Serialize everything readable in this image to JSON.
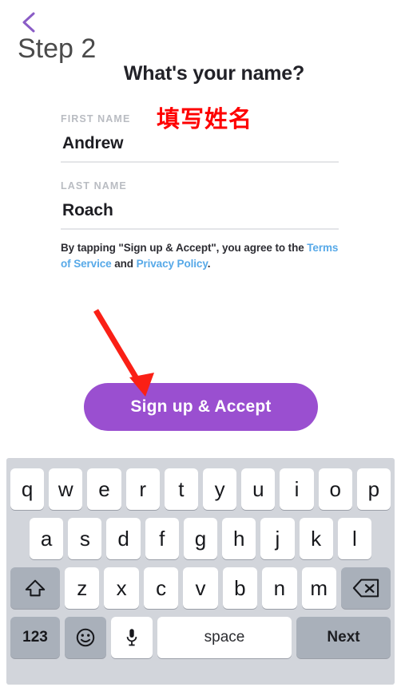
{
  "annotation": {
    "step_label": "Step 2",
    "chinese_note": "填写姓名",
    "note_color": "#fe0000",
    "arrow_color": "#fa2016",
    "back_icon": "chevron-left-icon",
    "back_icon_color": "#8a5cc6"
  },
  "screen": {
    "heading": "What's your name?",
    "fields": [
      {
        "label": "FIRST NAME",
        "value": "Andrew"
      },
      {
        "label": "LAST NAME",
        "value": "Roach"
      }
    ],
    "legal": {
      "prefix": "By tapping \"Sign up & Accept\", you agree to the ",
      "link_terms": "Terms of Service",
      "conjunction": " and ",
      "link_privacy": "Privacy Policy",
      "suffix": ".",
      "link_color": "#57a9e8"
    },
    "cta": {
      "label": "Sign up & Accept",
      "color": "#9a4fd0"
    }
  },
  "keyboard": {
    "background": "#d2d5db",
    "row1": [
      "q",
      "w",
      "e",
      "r",
      "t",
      "y",
      "u",
      "i",
      "o",
      "p"
    ],
    "row2": [
      "a",
      "s",
      "d",
      "f",
      "g",
      "h",
      "j",
      "k",
      "l"
    ],
    "row3": [
      "z",
      "x",
      "c",
      "v",
      "b",
      "n",
      "m"
    ],
    "shift_icon": "shift-arrow-icon",
    "backspace_icon": "backspace-delete-icon",
    "numeric_label": "123",
    "emoji_icon": "smiley-face-icon",
    "mic_icon": "microphone-icon",
    "space_label": "space",
    "next_label": "Next"
  }
}
